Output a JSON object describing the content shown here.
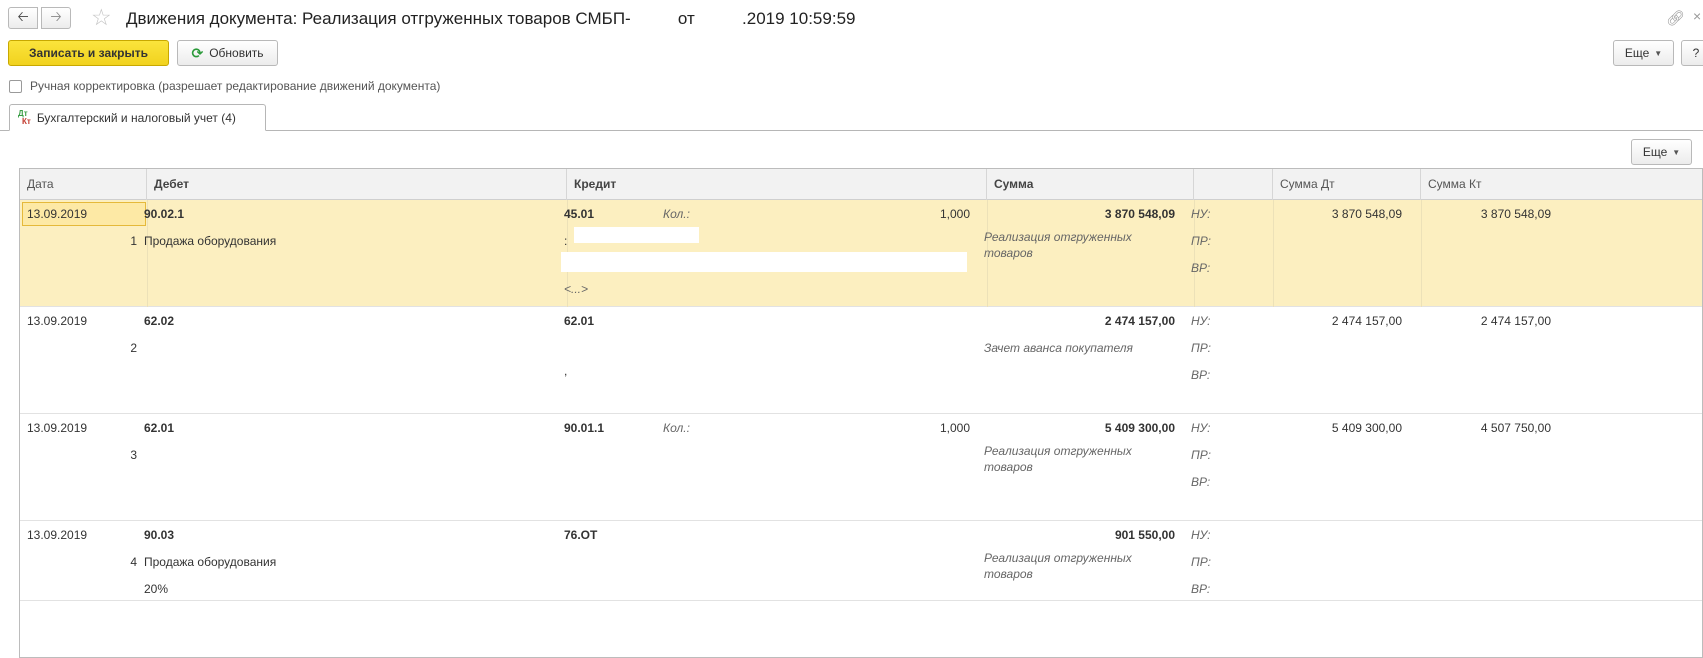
{
  "window": {
    "title": "Движения документа: Реализация отгруженных товаров СМБП-          от          .2019 10:59:59"
  },
  "toolbar": {
    "save_close": "Записать и закрыть",
    "refresh": "Обновить",
    "more": "Еще",
    "help": "?"
  },
  "manual_correction": {
    "label": "Ручная корректировка (разрешает редактирование движений документа)",
    "checked": false
  },
  "tab": {
    "icon_top": "Дт",
    "icon_bottom": "Кт",
    "label": "Бухгалтерский и налоговый учет (4)"
  },
  "table": {
    "more": "Еще",
    "headers": [
      "Дата",
      "Дебет",
      "Кредит",
      "Сумма",
      "",
      "Сумма Дт",
      "Сумма Кт"
    ],
    "rows": [
      {
        "date": "13.09.2019",
        "num": "1",
        "debit": "90.02.1",
        "debit_sub1": "Продажа оборудования",
        "credit": "45.01",
        "qty_label": "Кол.:",
        "qty": "1,000",
        "credit_sub1": ":",
        "credit_sub3": "<...>",
        "sum": "3 870 548,09",
        "content": "Реализация отгруженных товаров",
        "nu": "НУ:",
        "pr": "ПР:",
        "vr": "ВР:",
        "sum_dt": "3 870 548,09",
        "sum_kt": "3 870 548,09"
      },
      {
        "date": "13.09.2019",
        "num": "2",
        "debit": "62.02",
        "credit": "62.01",
        "credit_sub2": ",",
        "sum": "2 474 157,00",
        "content": "Зачет аванса покупателя",
        "nu": "НУ:",
        "pr": "ПР:",
        "vr": "ВР:",
        "sum_dt": "2 474 157,00",
        "sum_kt": "2 474 157,00"
      },
      {
        "date": "13.09.2019",
        "num": "3",
        "debit": "62.01",
        "credit": "90.01.1",
        "qty_label": "Кол.:",
        "qty": "1,000",
        "sum": "5 409 300,00",
        "content": "Реализация отгруженных товаров",
        "nu": "НУ:",
        "pr": "ПР:",
        "vr": "ВР:",
        "sum_dt": "5 409 300,00",
        "sum_kt": "4 507 750,00"
      },
      {
        "date": "13.09.2019",
        "num": "4",
        "debit": "90.03",
        "debit_sub1": "Продажа оборудования",
        "debit_sub2": "20%",
        "credit": "76.ОТ",
        "sum": "901 550,00",
        "content": "Реализация отгруженных товаров",
        "nu": "НУ:",
        "pr": "ПР:",
        "vr": "ВР:"
      }
    ]
  },
  "colors": {
    "primary_button": "#f5d928",
    "selected_row": "#fcefc0",
    "refresh_icon": "#2b9a3a"
  }
}
